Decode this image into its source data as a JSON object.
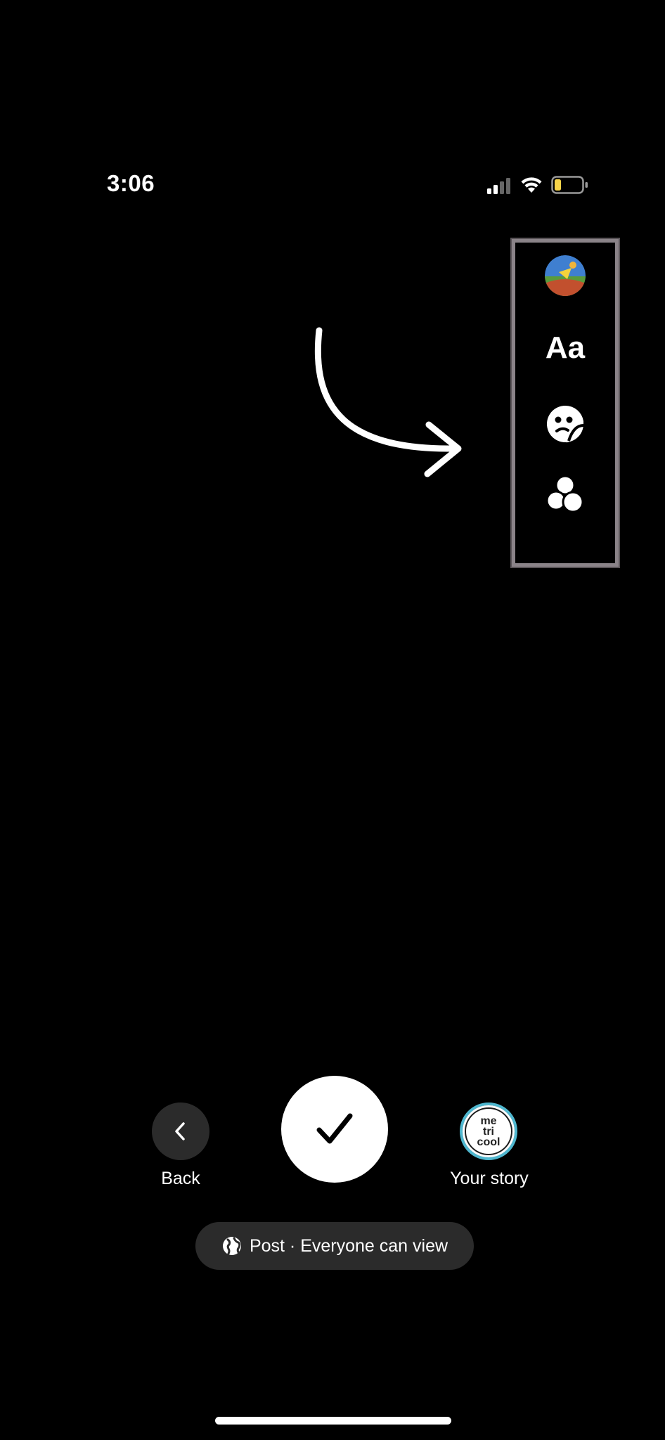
{
  "status_bar": {
    "time": "3:06",
    "icons": [
      "cellular-signal-icon",
      "wifi-icon",
      "battery-low-icon"
    ],
    "battery_color": "#f7d449"
  },
  "tool_panel": {
    "items": [
      {
        "name": "avatar",
        "icon": "profile-avatar-icon"
      },
      {
        "name": "text",
        "label": "Aa"
      },
      {
        "name": "sticker",
        "icon": "sticker-icon"
      },
      {
        "name": "effects",
        "icon": "effects-icon"
      }
    ]
  },
  "controls": {
    "back_label": "Back",
    "confirm_icon": "checkmark-icon",
    "story_avatar_lines": [
      "me",
      "tri",
      "cool"
    ],
    "story_label": "Your story"
  },
  "privacy": {
    "icon": "globe-icon",
    "text": "Post · Everyone can view"
  },
  "colors": {
    "background": "#000000",
    "panel_border": "#8a8388",
    "button_dark": "#2b2b2b",
    "story_ring": "#4fb7cf"
  }
}
